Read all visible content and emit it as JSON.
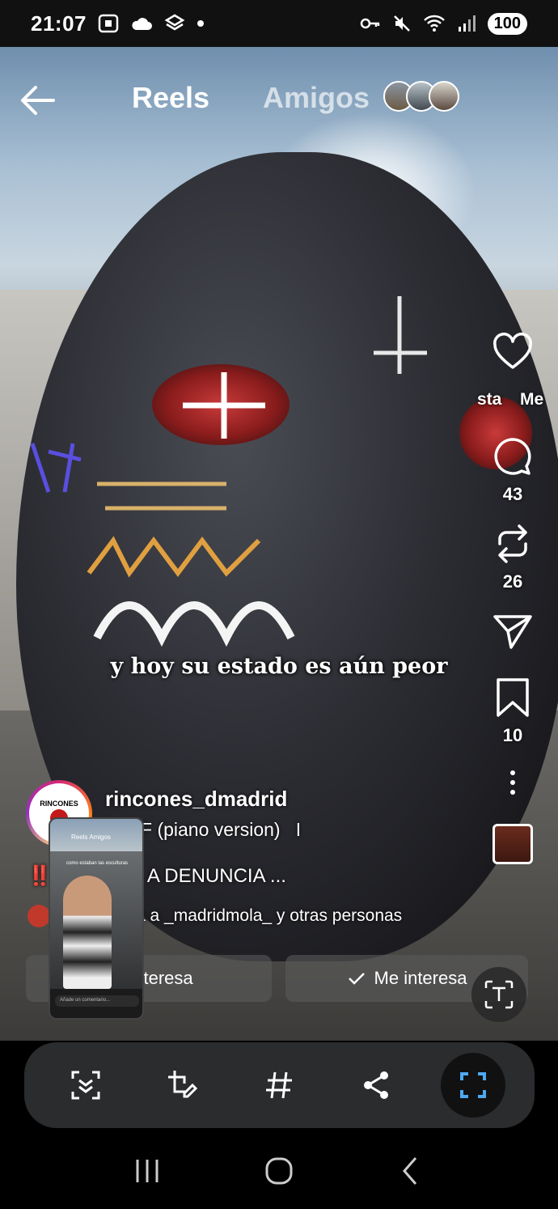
{
  "status_bar": {
    "time": "21:07",
    "battery": "100",
    "left_icons": [
      "screenshot-icon",
      "cloud-icon",
      "stack-icon",
      "dot-icon"
    ],
    "right_icons": [
      "key-icon",
      "mute-icon",
      "wifi-icon",
      "signal-icon"
    ]
  },
  "header": {
    "tab_reels": "Reels",
    "tab_amigos": "Amigos"
  },
  "subtitle": "y hoy su estado es aún peor",
  "actions": {
    "likes_label": "",
    "comments_count": "43",
    "reposts_count": "26",
    "saves_count": "10"
  },
  "overflow_text": {
    "left": "sta",
    "right": "Me"
  },
  "author": {
    "avatar_text": "RINCONES",
    "username": "rincones_dmadrid",
    "audio": "F (piano version)",
    "audio_cursor": "I"
  },
  "caption": {
    "prefix": "‼️",
    "text": "A DENUNCIA ...",
    "mention_text": "a a _madridmola_ y otras personas"
  },
  "buttons": {
    "interest_a": "e interesa",
    "interest_b": "Me interesa"
  },
  "mini_preview": {
    "top_label": "Reels   Amigos",
    "caption": "como estaban las esculturas",
    "input_placeholder": "Añade un comentario..."
  },
  "toolbar": {
    "items": [
      "smart-select-icon",
      "crop-edit-icon",
      "hashtag-icon",
      "share-icon",
      "capture-icon"
    ]
  },
  "nav": [
    "recents-icon",
    "home-icon",
    "back-icon"
  ]
}
